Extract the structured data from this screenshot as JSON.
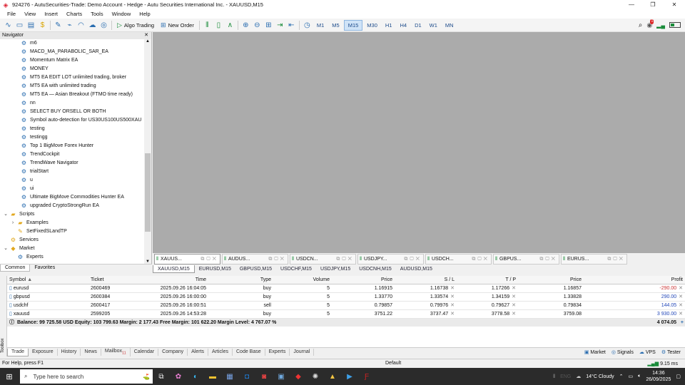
{
  "title": "924276 - AutuSecurities-Trade: Demo Account - Hedge - Autu Securities International Inc. - XAUUSD,M15",
  "menu": [
    "File",
    "View",
    "Insert",
    "Charts",
    "Tools",
    "Window",
    "Help"
  ],
  "toolbar": {
    "algo_trading": "Algo Trading",
    "new_order": "New Order",
    "timeframes": [
      "M1",
      "M5",
      "M15",
      "M30",
      "H1",
      "H4",
      "D1",
      "W1",
      "MN"
    ],
    "active_tf": "M15",
    "notifications": "1"
  },
  "navigator": {
    "title": "Navigator",
    "items": [
      {
        "label": "m6",
        "type": "ea",
        "level": 2
      },
      {
        "label": "MACD_MA_PARABOLIC_SAR_EA",
        "type": "ea",
        "level": 2
      },
      {
        "label": "Momentum Matrix EA",
        "type": "ea",
        "level": 2
      },
      {
        "label": "MONEY",
        "type": "ea",
        "level": 2
      },
      {
        "label": "MT5 EA EDIT LOT unlimited trading, broker",
        "type": "ea",
        "level": 2
      },
      {
        "label": "MT5 EA with unlimited trading",
        "type": "ea",
        "level": 2
      },
      {
        "label": "MT5 EA — Asian Breakout (FTMO time ready)",
        "type": "ea",
        "level": 2
      },
      {
        "label": "nn",
        "type": "ea",
        "level": 2
      },
      {
        "label": "SELECT BUY ORSELL OR BOTH",
        "type": "ea",
        "level": 2
      },
      {
        "label": "Symbol auto-detection for US30US100US500XAU",
        "type": "ea",
        "level": 2
      },
      {
        "label": "testing",
        "type": "ea",
        "level": 2
      },
      {
        "label": "testingg",
        "type": "ea",
        "level": 2
      },
      {
        "label": "Top 1 BigMove Forex Hunter",
        "type": "ea",
        "level": 2
      },
      {
        "label": "TrendCockpit",
        "type": "ea",
        "level": 2
      },
      {
        "label": "TrendWave Navigator",
        "type": "ea",
        "level": 2
      },
      {
        "label": "trialStart",
        "type": "ea",
        "level": 2
      },
      {
        "label": "u",
        "type": "ea",
        "level": 2
      },
      {
        "label": "ui",
        "type": "ea",
        "level": 2
      },
      {
        "label": "Ultimate BigMove Commodities Hunter EA",
        "type": "ea",
        "level": 2
      },
      {
        "label": "upgraded CryptoStrongRun EA",
        "type": "ea",
        "level": 2
      },
      {
        "label": "Scripts",
        "type": "folder",
        "level": 0,
        "toggle": "⌄"
      },
      {
        "label": "Examples",
        "type": "folder",
        "level": 1,
        "toggle": "›"
      },
      {
        "label": "SetFixedSLandTP",
        "type": "script",
        "level": 1
      },
      {
        "label": "Services",
        "type": "service",
        "level": 0
      },
      {
        "label": "Market",
        "type": "market",
        "level": 0,
        "toggle": "⌄"
      },
      {
        "label": "Experts",
        "type": "ea",
        "level": 1
      }
    ],
    "tabs": [
      "Common",
      "Favorites"
    ]
  },
  "chart_tabs": [
    {
      "label": "XAUUS..."
    },
    {
      "label": "AUDUS..."
    },
    {
      "label": "USDCN..."
    },
    {
      "label": "USDJPY..."
    },
    {
      "label": "USDCH..."
    },
    {
      "label": "GBPUS..."
    },
    {
      "label": "EURUS..."
    }
  ],
  "symbol_tabs": [
    "XAUUSD,M15",
    "EURUSD,M15",
    "GBPUSD,M15",
    "USDCHF,M15",
    "USDJPY,M15",
    "USDCNH,M15",
    "AUDUSD,M15"
  ],
  "trade": {
    "headers": [
      "Symbol",
      "Ticket",
      "Time",
      "Type",
      "Volume",
      "Price",
      "S / L",
      "T / P",
      "Price",
      "Profit"
    ],
    "rows": [
      {
        "symbol": "eurusd",
        "ticket": "2600469",
        "time": "2025.09.26 16:04:05",
        "type": "buy",
        "volume": "5",
        "price": "1.16915",
        "sl": "1.16738",
        "tp": "1.17266",
        "cur": "1.16857",
        "profit": "-290.00",
        "neg": true
      },
      {
        "symbol": "gbpusd",
        "ticket": "2600384",
        "time": "2025.09.26 16:00:00",
        "type": "buy",
        "volume": "5",
        "price": "1.33770",
        "sl": "1.33574",
        "tp": "1.34159",
        "cur": "1.33828",
        "profit": "290.00",
        "neg": false
      },
      {
        "symbol": "usdchf",
        "ticket": "2600417",
        "time": "2025.09.26 16:00:51",
        "type": "sell",
        "volume": "5",
        "price": "0.79857",
        "sl": "0.79976",
        "tp": "0.79627",
        "cur": "0.79834",
        "profit": "144.05",
        "neg": false
      },
      {
        "symbol": "xauusd",
        "ticket": "2599205",
        "time": "2025.09.26 14:53:28",
        "type": "buy",
        "volume": "5",
        "price": "3751.22",
        "sl": "3737.47",
        "tp": "3778.58",
        "cur": "3759.08",
        "profit": "3 930.00",
        "neg": false
      }
    ],
    "balance_line": "Balance: 99 725.58 USD  Equity: 103 799.63  Margin: 2 177.43  Free Margin: 101 622.20  Margin Level: 4 767.07 %",
    "total": "4 074.05"
  },
  "toolbox_label": "Toolbox",
  "bottom_tabs": [
    {
      "label": "Trade"
    },
    {
      "label": "Exposure"
    },
    {
      "label": "History"
    },
    {
      "label": "News"
    },
    {
      "label": "Mailbox",
      "badge": "11"
    },
    {
      "label": "Calendar"
    },
    {
      "label": "Company"
    },
    {
      "label": "Alerts"
    },
    {
      "label": "Articles"
    },
    {
      "label": "Code Base"
    },
    {
      "label": "Experts"
    },
    {
      "label": "Journal"
    }
  ],
  "bottom_right": [
    "Market",
    "Signals",
    "VPS",
    "Tester"
  ],
  "status": {
    "help": "For Help, press F1",
    "profile": "Default",
    "ping": "9.15 ms"
  },
  "taskbar": {
    "search_placeholder": "Type here to search",
    "weather": "14°C  Cloudy",
    "time": "14:36",
    "date": "26/09/2025",
    "lang": "ENG"
  }
}
